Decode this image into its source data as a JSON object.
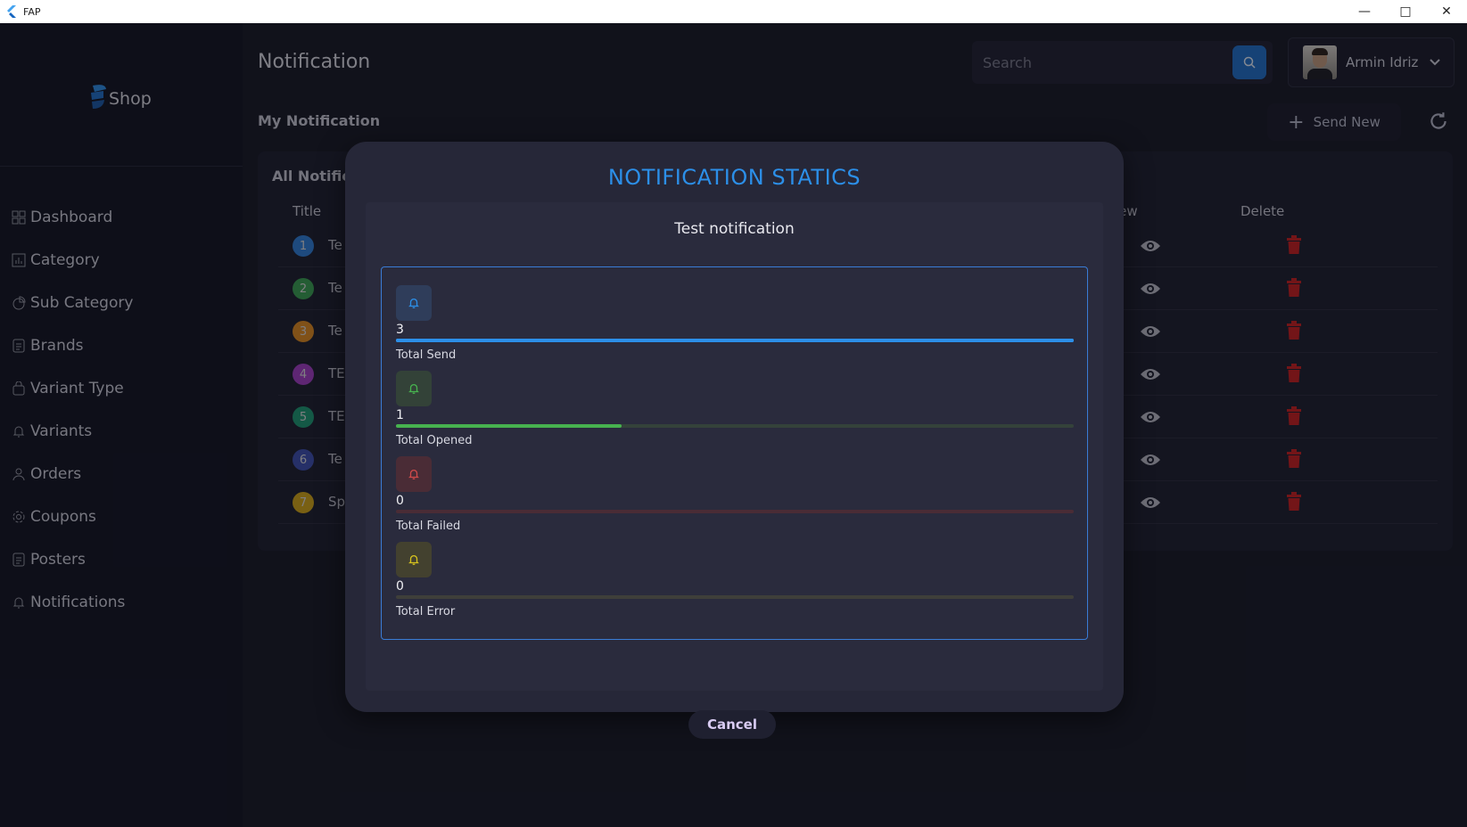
{
  "window": {
    "title": "FAP"
  },
  "brand": {
    "logo_text": "Shop"
  },
  "sidebar": {
    "items": [
      {
        "label": "Dashboard",
        "icon": "dashboard-icon"
      },
      {
        "label": "Category",
        "icon": "chart-icon"
      },
      {
        "label": "Sub Category",
        "icon": "pie-icon"
      },
      {
        "label": "Brands",
        "icon": "document-icon"
      },
      {
        "label": "Variant Type",
        "icon": "bag-icon"
      },
      {
        "label": "Variants",
        "icon": "bell-icon"
      },
      {
        "label": "Orders",
        "icon": "user-icon"
      },
      {
        "label": "Coupons",
        "icon": "gear-icon"
      },
      {
        "label": "Posters",
        "icon": "document-icon"
      },
      {
        "label": "Notifications",
        "icon": "bell-icon"
      }
    ]
  },
  "header": {
    "title": "Notification",
    "search_placeholder": "Search",
    "user_name": "Armin Idriz"
  },
  "section": {
    "title": "My Notification",
    "send_new_label": "Send New"
  },
  "table": {
    "card_title": "All Notifications",
    "columns": {
      "title": "Title",
      "view": "View",
      "delete": "Delete"
    },
    "rows": [
      {
        "num": "1",
        "title": "Te",
        "color": "#2f7fd8"
      },
      {
        "num": "2",
        "title": "Te",
        "color": "#3aa150"
      },
      {
        "num": "3",
        "title": "Te",
        "color": "#e08a1e"
      },
      {
        "num": "4",
        "title": "TE",
        "color": "#a23cc4"
      },
      {
        "num": "5",
        "title": "TE",
        "color": "#1d9a72"
      },
      {
        "num": "6",
        "title": "Te",
        "color": "#3c4fb0"
      },
      {
        "num": "7",
        "title": "Sp",
        "color": "#d4a614"
      }
    ]
  },
  "dialog": {
    "title": "NOTIFICATION STATICS",
    "notification_title": "Test notification",
    "cancel_label": "Cancel",
    "stats": [
      {
        "value": "3",
        "label": "Total Send",
        "progress": 1.0,
        "color": "#2c8fe8",
        "icon_bg": "#2f3d5a",
        "track": "#2c8fe8"
      },
      {
        "value": "1",
        "label": "Total Opened",
        "progress": 0.333,
        "color": "#47b24f",
        "icon_bg": "#334238",
        "track": "#34423a"
      },
      {
        "value": "0",
        "label": "Total Failed",
        "progress": 0.0,
        "color": "#d04a4a",
        "icon_bg": "#4a2c36",
        "track": "#4a2c36"
      },
      {
        "value": "0",
        "label": "Total Error",
        "progress": 0.0,
        "color": "#d6c21e",
        "icon_bg": "#43412f",
        "track": "#3f3f3a"
      }
    ]
  }
}
